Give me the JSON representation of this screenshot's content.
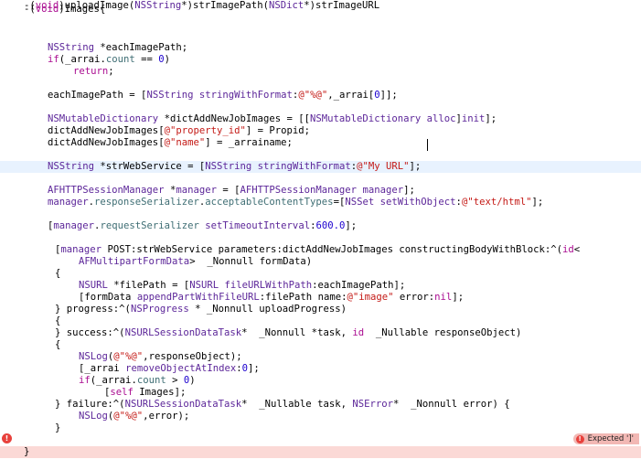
{
  "code_lines": [
    "-(void)Images{",
    "",
    "    NSString *eachImagePath;",
    "    if(_arrai.count == 0)",
    "        return;",
    "",
    "    eachImagePath = [NSString stringWithFormat:@\"%@\",_arrai[0]];",
    "",
    "    NSMutableDictionary *dictAddNewJobImages = [[NSMutableDictionary alloc]init];",
    "    dictAddNewJobImages[@\"property_id\"] = Propid;",
    "    dictAddNewJobImages[@\"name\"] = _arrainame;",
    "",
    "    NSString *strWebService = [NSString stringWithFormat:@\"My URL\"];",
    "",
    "    AFHTTPSessionManager *manager = [AFHTTPSessionManager manager];",
    "    manager.responseSerializer.acceptableContentTypes=[NSSet setWithObject:@\"text/html\"];",
    "",
    "    [manager.requestSerializer setTimeoutInterval:600.0];",
    "",
    "     [manager POST:strWebService parameters:dictAddNewJobImages constructingBodyWithBlock:^(id<",
    "        AFMultipartFormData>  _Nonnull formData)",
    "     {",
    "        NSURL *filePath = [NSURL fileURLWithPath:eachImagePath];",
    "        [formData appendPartWithFileURL:filePath name:@\"image\" error:nil];",
    "     } progress:^(NSProgress * _Nonnull uploadProgress)",
    "     {",
    "     } success:^(NSURLSessionDataTask*  _Nonnull *task, id  _Nullable responseObject)",
    "     {",
    "        NSLog(@\"%@\",responseObject);",
    "        [_arrai removeObjectAtIndex:0];",
    "        if(_arrai.count > 0)",
    "            [self Images];",
    "     } failure:^(NSURLSessionDataTask*  _Nullable task, NSError*  _Nonnull error) {",
    "        NSLog(@\"%@\",error);",
    "     }",
    "",
    "}",
    "",
    "-(void)uploadImage(NSString*)strImagePath(NSDict*)strImageURL"
  ],
  "error_message": "Expected ']'",
  "icons": {
    "gutter_error": "error-icon",
    "badge_error": "error-icon"
  }
}
